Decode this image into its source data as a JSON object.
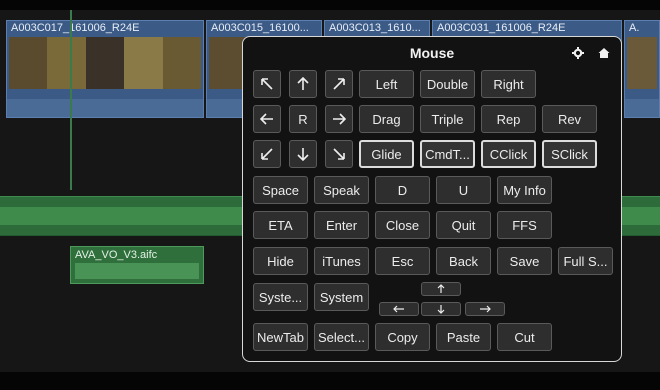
{
  "timeline": {
    "clips": [
      {
        "title": "A003C017_161006_R24E"
      },
      {
        "title": "A003C015_16100..."
      },
      {
        "title": "A003C013_1610..."
      },
      {
        "title": "A003C031_161006_R24E"
      },
      {
        "title": "A."
      }
    ],
    "audio_clip_label": "AVA_VO_V3.aifc"
  },
  "panel": {
    "title": "Mouse",
    "header_icons": [
      "gear-icon",
      "home-icon"
    ],
    "row1": [
      "Left",
      "Double",
      "Right"
    ],
    "row2": [
      "R",
      "Drag",
      "Triple",
      "Rep",
      "Rev"
    ],
    "row3": [
      "Glide",
      "CmdT...",
      "CClick",
      "SClick"
    ],
    "row4": [
      "Space",
      "Speak",
      "D",
      "U",
      "My Info"
    ],
    "row5": [
      "ETA",
      "Enter",
      "Close",
      "Quit",
      "FFS"
    ],
    "row6": [
      "Hide",
      "iTunes",
      "Esc",
      "Back",
      "Save",
      "Full S..."
    ],
    "row7": [
      "Syste...",
      "System"
    ],
    "row8": [
      "NewTab",
      "Select...",
      "Copy",
      "Paste",
      "Cut"
    ]
  }
}
